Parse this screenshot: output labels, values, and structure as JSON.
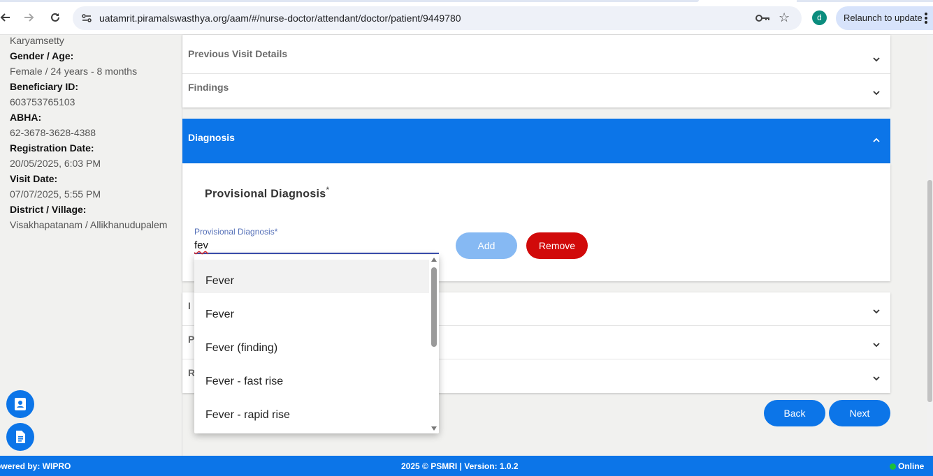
{
  "browser": {
    "url": "uatamrit.piramalswasthya.org/aam/#/nurse-doctor/attendant/doctor/patient/9449780",
    "profile_initial": "d",
    "relaunch_label": "Relaunch to update"
  },
  "sidebar": {
    "name_tail": "Karyamsetty",
    "fields": [
      {
        "label": "Gender / Age:",
        "value": "Female / 24 years - 8 months"
      },
      {
        "label": "Beneficiary ID:",
        "value": "603753765103"
      },
      {
        "label": "ABHA:",
        "value": "62-3678-3628-4388"
      },
      {
        "label": "Registration Date:",
        "value": "20/05/2025, 6:03 PM"
      },
      {
        "label": "Visit Date:",
        "value": "07/07/2025, 5:55 PM"
      },
      {
        "label": "District / Village:",
        "value": "Visakhapatanam / Allikhanudupalem"
      }
    ]
  },
  "accordion": {
    "previous_visit": "Previous Visit Details",
    "findings": "Findings",
    "diagnosis": "Diagnosis",
    "lower_letters": [
      "I",
      "P",
      "R"
    ]
  },
  "diagnosis": {
    "section_title": "Provisional Diagnosis",
    "required_mark": "*",
    "field_label": "Provisional Diagnosis*",
    "field_value": "fev",
    "add_label": "Add",
    "remove_label": "Remove"
  },
  "suggestions": [
    "Fever",
    "Fever",
    "Fever (finding)",
    "Fever - fast rise",
    "Fever - rapid rise"
  ],
  "nav": {
    "back_label": "Back",
    "next_label": "Next"
  },
  "footer": {
    "powered_by": "owered by: WIPRO",
    "center": "2025 © PSMRI  |  Version: 1.0.2",
    "status": "Online"
  },
  "colors": {
    "primary": "#0c75e8",
    "remove": "#d10a0a",
    "add_disabled": "#86b9f3",
    "online": "#1bbf3a"
  }
}
